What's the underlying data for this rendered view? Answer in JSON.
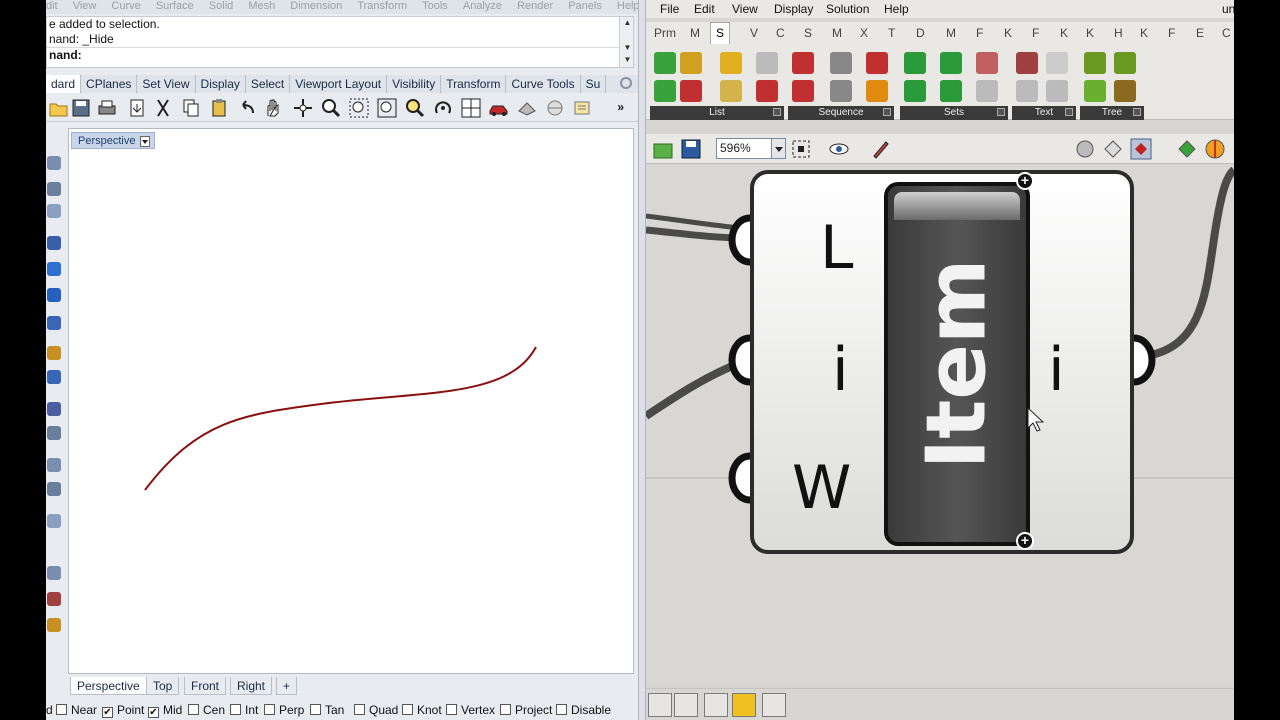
{
  "rhino": {
    "menu": [
      "dit",
      "View",
      "Curve",
      "Surface",
      "Solid",
      "Mesh",
      "Dimension",
      "Transform",
      "Tools",
      "Analyze",
      "Render",
      "Panels",
      "Help"
    ],
    "command_history": [
      "e added to selection.",
      "nand: _Hide"
    ],
    "command_prompt": "nand:",
    "toolbar_tabs": [
      "dard",
      "CPlanes",
      "Set View",
      "Display",
      "Select",
      "Viewport Layout",
      "Visibility",
      "Transform",
      "Curve Tools",
      "Su"
    ],
    "toolbar_more": "»",
    "viewport": {
      "title": "Perspective"
    },
    "viewport_tabs": [
      "Perspective",
      "Top",
      "Front",
      "Right"
    ],
    "viewport_add": "+",
    "osnaps": [
      {
        "label": "d",
        "checked": null
      },
      {
        "label": "Near",
        "checked": false
      },
      {
        "label": "Point",
        "checked": true
      },
      {
        "label": "Mid",
        "checked": true
      },
      {
        "label": "Cen",
        "checked": false
      },
      {
        "label": "Int",
        "checked": false
      },
      {
        "label": "Perp",
        "checked": false
      },
      {
        "label": "Tan",
        "checked": false
      },
      {
        "label": "Quad",
        "checked": false
      },
      {
        "label": "Knot",
        "checked": false
      },
      {
        "label": "Vertex",
        "checked": false
      },
      {
        "label": "Project",
        "checked": false
      },
      {
        "label": "Disable",
        "checked": false
      }
    ],
    "check_mark": "✔",
    "curve_color": "#8a1010"
  },
  "grasshopper": {
    "menu": [
      "File",
      "Edit",
      "View",
      "Display",
      "Solution",
      "Help"
    ],
    "title_fragment": "un",
    "tabs": [
      "Prm",
      "M",
      "S",
      "V",
      "C",
      "S",
      "M",
      "X",
      "T",
      "D",
      "M",
      "F",
      "K",
      "F",
      "K",
      "K",
      "H",
      "K",
      "F",
      "E",
      "C"
    ],
    "active_tab_index": 2,
    "ribbon_groups": [
      "List",
      "Sequence",
      "Sets",
      "Text",
      "Tree"
    ],
    "zoom": "596%",
    "component": {
      "name": "Item",
      "inputs": [
        "L",
        "i",
        "W"
      ],
      "outputs": [
        "i"
      ],
      "grip_symbol": "+"
    }
  }
}
